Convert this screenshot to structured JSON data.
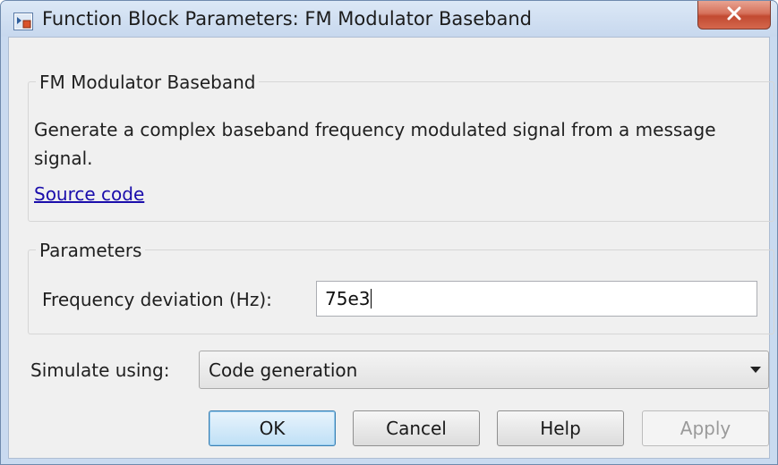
{
  "window": {
    "title": "Function Block Parameters: FM Modulator Baseband",
    "close_glyph": "X"
  },
  "block_group": {
    "legend": "FM Modulator Baseband",
    "description": "Generate a complex baseband frequency modulated signal from a message signal.",
    "link_text": "Source code"
  },
  "parameters_group": {
    "legend": "Parameters",
    "frequency_deviation": {
      "label": "Frequency deviation (Hz):",
      "value": "75e3"
    }
  },
  "simulate": {
    "label": "Simulate using:",
    "selected": "Code generation"
  },
  "buttons": {
    "ok": "OK",
    "cancel": "Cancel",
    "help": "Help",
    "apply": "Apply"
  },
  "colors": {
    "title_bar": "#c7d8ee",
    "close_button": "#c24a31",
    "dialog_bg": "#f0f0f0",
    "link": "#1a0dab",
    "default_button_border": "#3c7fb1"
  }
}
